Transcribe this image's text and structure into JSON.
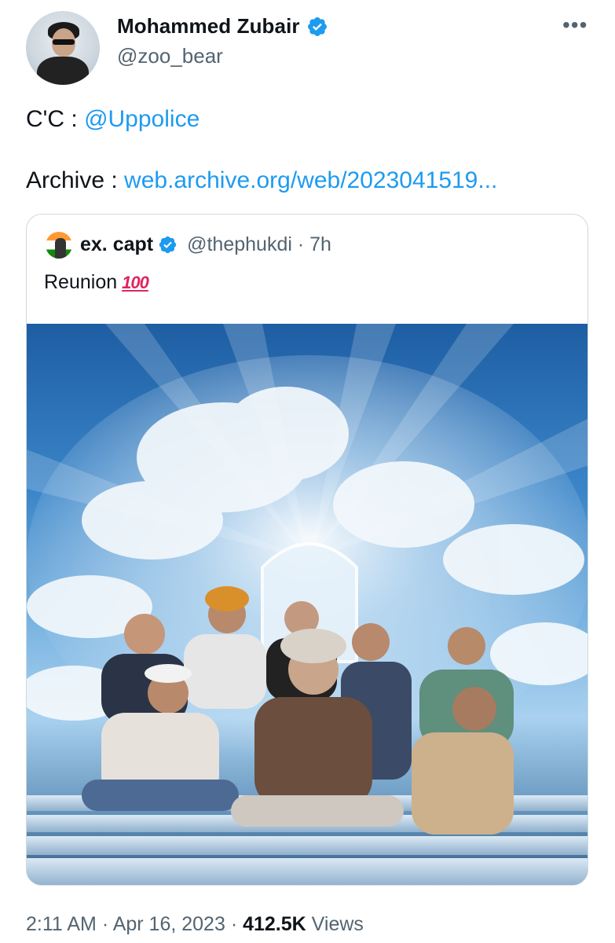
{
  "author": {
    "display_name": "Mohammed Zubair",
    "handle": "@zoo_bear"
  },
  "tweet": {
    "cc_prefix": "C'C : ",
    "cc_mention": "@Uppolice",
    "archive_prefix": "Archive : ",
    "archive_link": "web.archive.org/web/2023041519..."
  },
  "quote": {
    "display_name": "ex. capt",
    "handle_time": "@thephukdi · 7h",
    "text": "Reunion",
    "emoji": "100"
  },
  "footer": {
    "time_date": "2:11 AM · Apr 16, 2023 · ",
    "views_count": "412.5K",
    "views_label": " Views"
  },
  "more_label": "•••",
  "colors": {
    "link": "#1d9bf0",
    "verified": "#1d9bf0",
    "muted": "#536471"
  }
}
